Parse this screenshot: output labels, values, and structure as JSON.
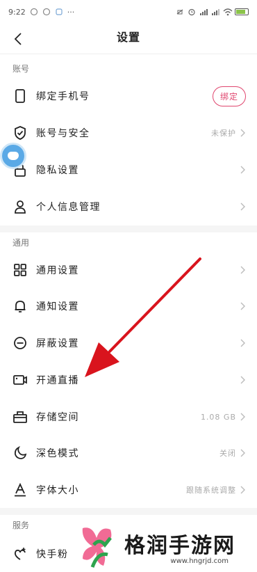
{
  "status_bar": {
    "time": "9:22",
    "dots": "···"
  },
  "nav": {
    "title": "设置"
  },
  "sections": {
    "account": "账号",
    "general": "通用",
    "service": "服务"
  },
  "rows": {
    "bind_phone": {
      "label": "绑定手机号",
      "button": "绑定"
    },
    "account_security": {
      "label": "账号与安全",
      "value": "未保护"
    },
    "privacy": {
      "label": "隐私设置"
    },
    "personal_info": {
      "label": "个人信息管理"
    },
    "general_settings": {
      "label": "通用设置"
    },
    "notification": {
      "label": "通知设置"
    },
    "block": {
      "label": "屏蔽设置"
    },
    "live": {
      "label": "开通直播"
    },
    "storage": {
      "label": "存储空间",
      "value": "1.08 GB"
    },
    "dark_mode": {
      "label": "深色模式",
      "value": "关闭"
    },
    "font_size": {
      "label": "字体大小",
      "value": "跟随系统调整"
    },
    "kuaishou": {
      "label": "快手粉"
    }
  },
  "watermark": {
    "title": "格润手游网",
    "url": "www.hngrjd.com"
  },
  "colors": {
    "accent": "#e0466e",
    "arrow": "#d9141d"
  }
}
